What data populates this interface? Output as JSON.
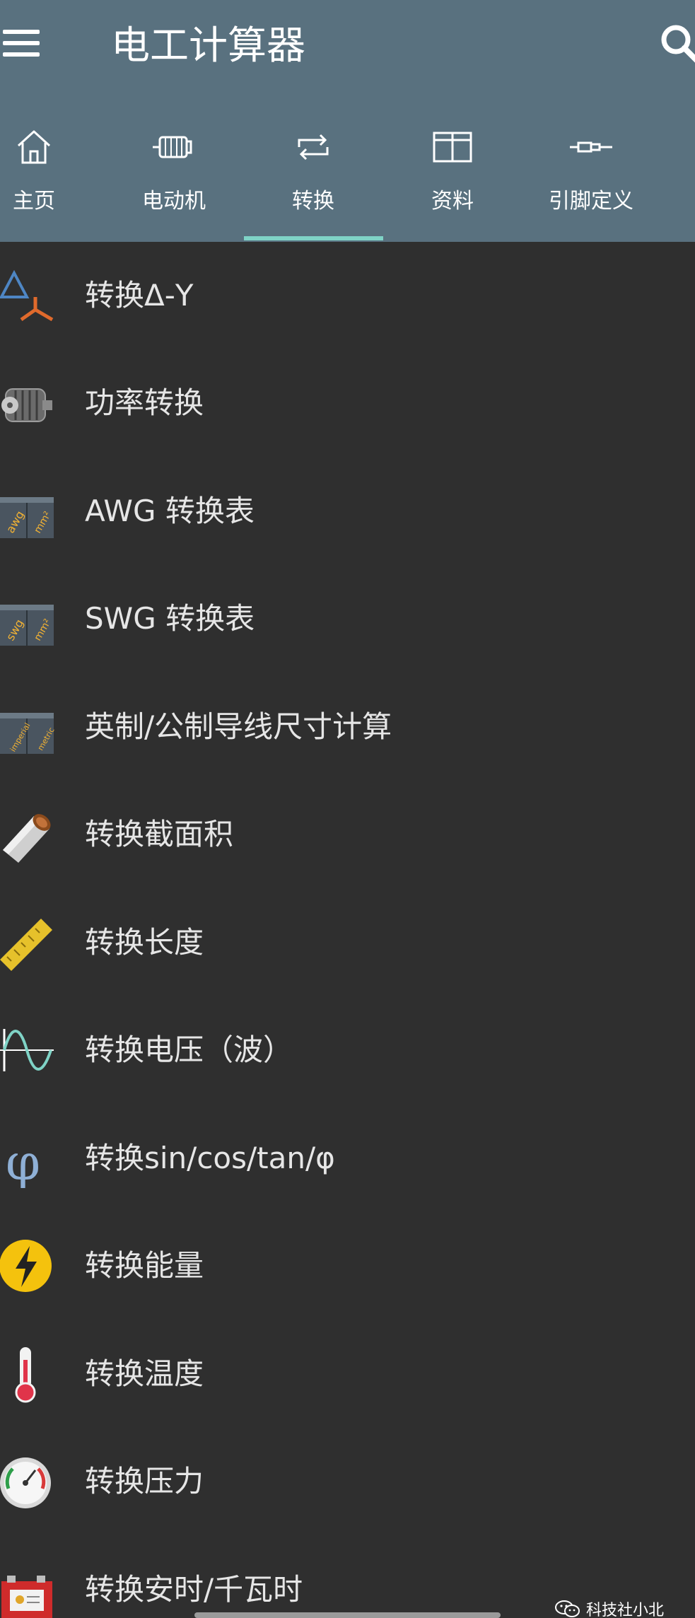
{
  "app": {
    "title": "电工计算器"
  },
  "icons": {
    "menu": "hamburger-menu-icon",
    "search": "search-icon"
  },
  "colors": {
    "appbar": "#59717f",
    "background": "#2f2f2f",
    "tab_indicator": "#7fd3c6",
    "text": "#e6e6e6"
  },
  "tabs": [
    {
      "label": "主页",
      "icon": "home-icon",
      "selected": false
    },
    {
      "label": "电动机",
      "icon": "motor-icon",
      "selected": false
    },
    {
      "label": "转换",
      "icon": "convert-arrows-icon",
      "selected": true
    },
    {
      "label": "资料",
      "icon": "book-icon",
      "selected": false
    },
    {
      "label": "引脚定义",
      "icon": "connector-icon",
      "selected": false
    }
  ],
  "items": [
    {
      "label": "转换Δ-Y",
      "icon": "delta-wye-icon"
    },
    {
      "label": "功率转换",
      "icon": "motor-photo-icon"
    },
    {
      "label": "AWG 转换表",
      "icon": "awg-mm2-icon",
      "icon_text": [
        "awg",
        "mm²"
      ]
    },
    {
      "label": "SWG 转换表",
      "icon": "swg-mm2-icon",
      "icon_text": [
        "swg",
        "mm²"
      ]
    },
    {
      "label": "英制/公制导线尺寸计算",
      "icon": "imperial-metric-icon",
      "icon_text": [
        "imperial",
        "metric"
      ]
    },
    {
      "label": "转换截面积",
      "icon": "cable-section-icon"
    },
    {
      "label": "转换长度",
      "icon": "ruler-icon"
    },
    {
      "label": "转换电压（波）",
      "icon": "sine-wave-icon"
    },
    {
      "label": "转换sin/cos/tan/φ",
      "icon": "phi-icon",
      "icon_text": [
        "φ"
      ]
    },
    {
      "label": "转换能量",
      "icon": "lightning-icon"
    },
    {
      "label": "转换温度",
      "icon": "thermometer-icon"
    },
    {
      "label": "转换压力",
      "icon": "pressure-gauge-icon"
    },
    {
      "label": "转换安时/千瓦时",
      "icon": "battery-icon"
    }
  ],
  "watermark": {
    "text": "科技社小北",
    "icon": "wechat-icon"
  }
}
